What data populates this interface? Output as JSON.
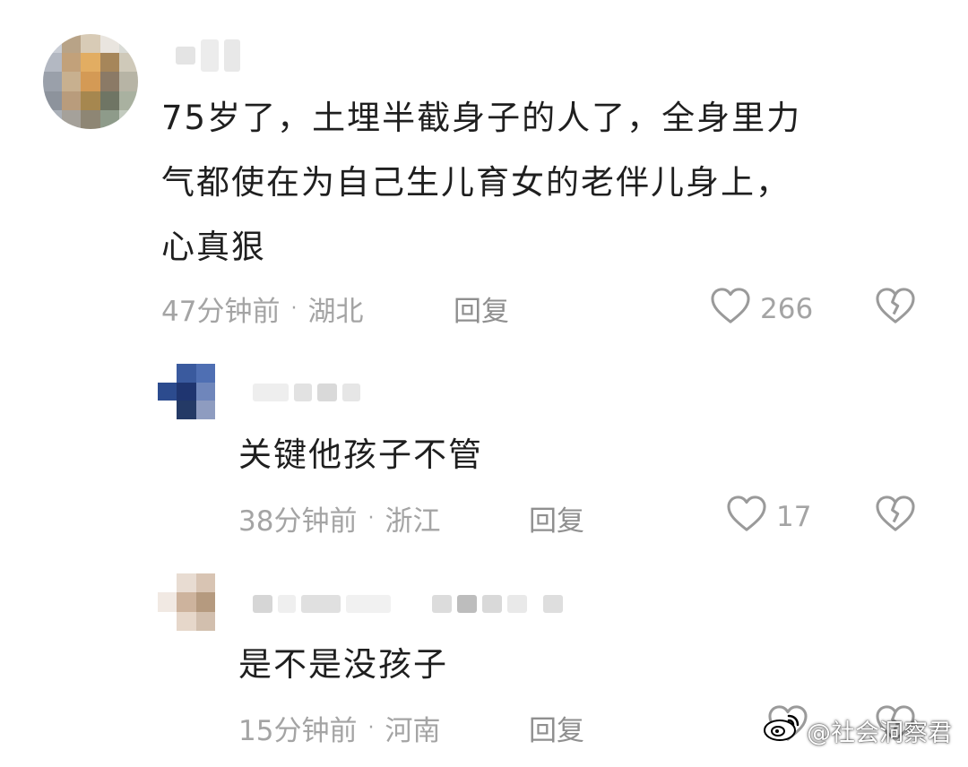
{
  "comments": [
    {
      "text_lines": [
        "75岁了，土埋半截身子的人了，全身里力",
        "气都使在为自己生儿育女的老伴儿身上，",
        "心真狠"
      ],
      "time": "47分钟前",
      "location": "湖北",
      "reply_label": "回复",
      "likes": "266"
    },
    {
      "text_lines": [
        "关键他孩子不管"
      ],
      "time": "38分钟前",
      "location": "浙江",
      "reply_label": "回复",
      "likes": "17"
    },
    {
      "text_lines": [
        "是不是没孩子"
      ],
      "time": "15分钟前",
      "location": "河南",
      "reply_label": "回复"
    }
  ],
  "separator": "·",
  "watermark": {
    "text": "@社会洞察君"
  },
  "colors": {
    "text": "#1f1f1f",
    "meta": "#a4a4a4",
    "icon": "#9a9a9a"
  },
  "icons": [
    "heart-outline-icon",
    "broken-heart-icon",
    "weibo-logo-icon"
  ]
}
